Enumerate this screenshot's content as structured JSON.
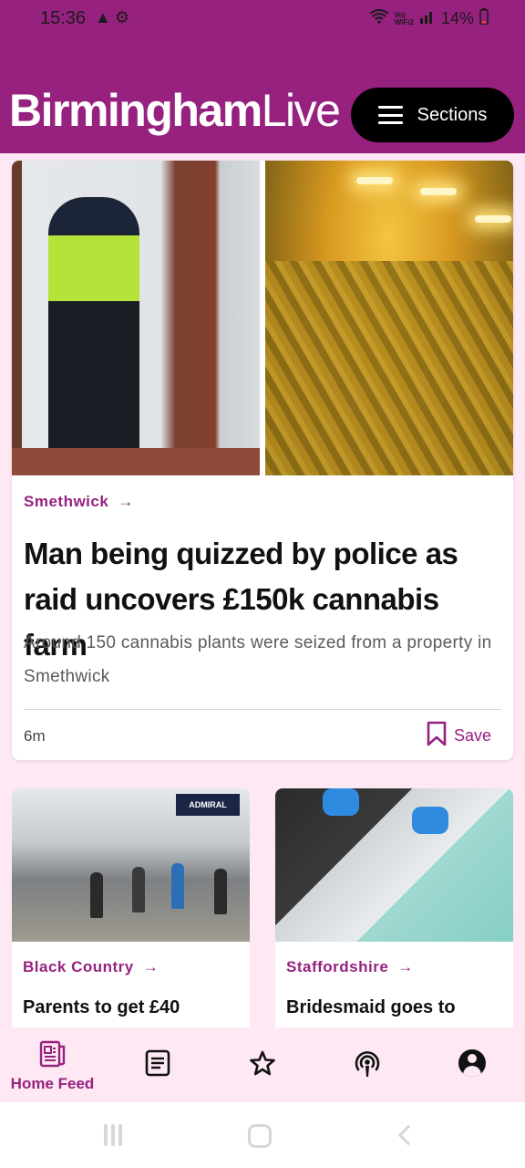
{
  "status_bar": {
    "time": "15:36",
    "left_icons": [
      "warning-icon",
      "settings-icon"
    ],
    "network_label": "VoLTE WiFi2",
    "battery": "14%"
  },
  "header": {
    "logo_bold": "Birmingham",
    "logo_light": "Live",
    "sections_label": "Sections",
    "brand_color": "#96217f"
  },
  "lead_story": {
    "category": "Smethwick",
    "headline": "Man being quizzed by police as raid uncovers £150k cannabis farm",
    "standfirst": "Around 150 cannabis plants were seized from a property in Smethwick",
    "time": "6m",
    "save_label": "Save"
  },
  "stories": [
    {
      "category": "Black Country",
      "headline": "Parents to get £40",
      "shop_sign": "ADMIRAL"
    },
    {
      "category": "Staffordshire",
      "headline": "Bridesmaid goes to"
    }
  ],
  "bottom_nav": {
    "items": [
      {
        "label": "Home Feed",
        "icon": "home-feed-icon",
        "active": true
      },
      {
        "label": "",
        "icon": "article-icon",
        "active": false
      },
      {
        "label": "",
        "icon": "star-icon",
        "active": false
      },
      {
        "label": "",
        "icon": "podcast-icon",
        "active": false
      },
      {
        "label": "",
        "icon": "account-icon",
        "active": false
      }
    ]
  }
}
